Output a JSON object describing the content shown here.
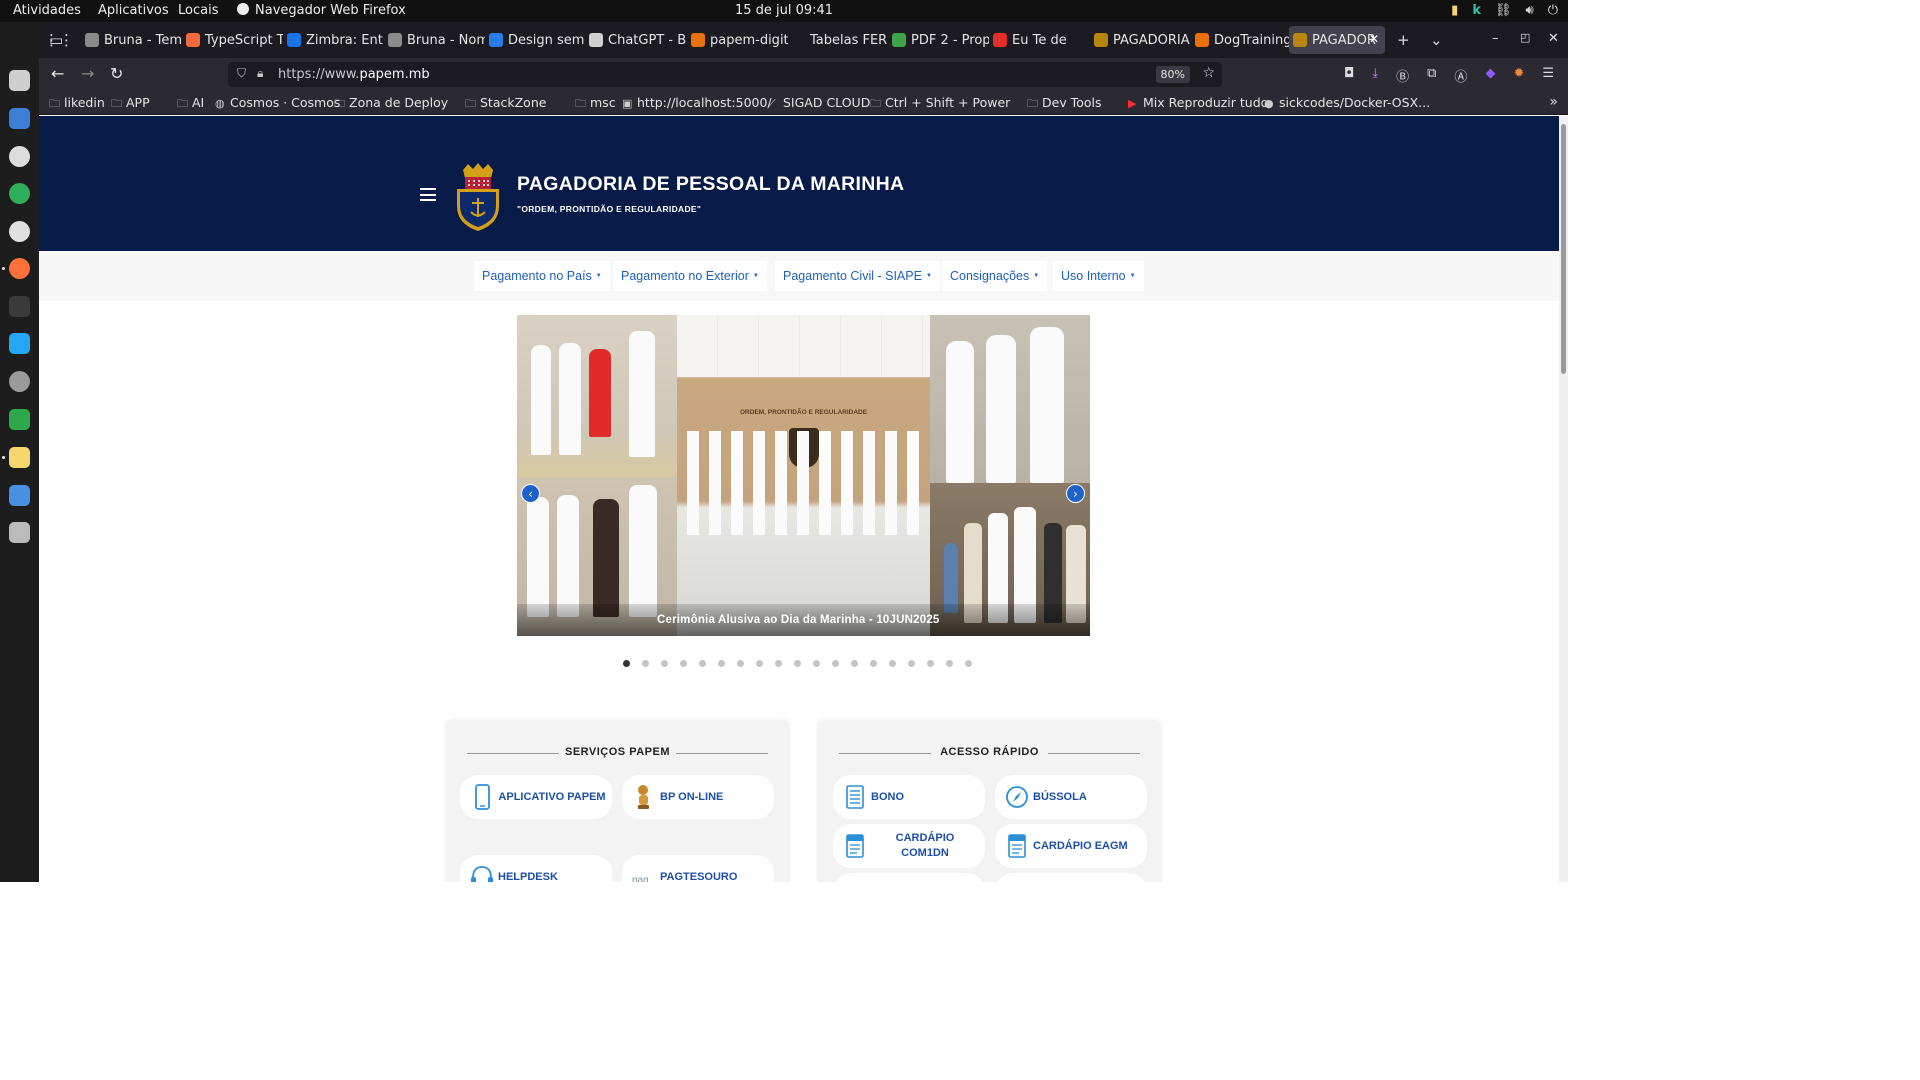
{
  "system": {
    "activities": "Atividades",
    "apps": "Aplicativos",
    "places": "Locais",
    "focused_app": "Navegador Web Firefox",
    "clock": "15 de jul  09:41"
  },
  "browser": {
    "tabs": [
      {
        "label": "Bruna - Tem",
        "color": "#8a8a8a"
      },
      {
        "label": "TypeScript T",
        "color": "#f26b3a"
      },
      {
        "label": "Zimbra: Ent",
        "color": "#1a73e8"
      },
      {
        "label": "Bruna - Nom",
        "color": "#8a8a8a"
      },
      {
        "label": "Design sem",
        "color": "#2b7de9"
      },
      {
        "label": "ChatGPT - B",
        "color": "#cfcfcf"
      },
      {
        "label": "papem-digit",
        "color": "#e8710a"
      },
      {
        "label": "Tabelas FER",
        "color": "#1c1b22"
      },
      {
        "label": "PDF 2 - Prop",
        "color": "#3ea34a"
      },
      {
        "label": "Eu Te de",
        "color": "#e52d27"
      },
      {
        "label": "PAGADORIA",
        "color": "#b8860b"
      },
      {
        "label": "DogTraining",
        "color": "#e8710a"
      },
      {
        "label": "PAGADOR",
        "color": "#b8860b"
      }
    ],
    "url_prefix": "https://www.",
    "url_domain": "papem.mb",
    "zoom": "80%",
    "bookmarks": [
      {
        "label": "likedin",
        "icon": "folder-icon"
      },
      {
        "label": "APP",
        "icon": "folder-icon"
      },
      {
        "label": "AI",
        "icon": "folder-icon"
      },
      {
        "label": "Cosmos · Cosmos",
        "icon": "globe-icon"
      },
      {
        "label": "Zona de Deploy",
        "icon": "folder-icon"
      },
      {
        "label": "StackZone",
        "icon": "folder-icon"
      },
      {
        "label": "msc",
        "icon": "folder-icon"
      },
      {
        "label": "http://localhost:5000/",
        "icon": "page-icon"
      },
      {
        "label": "SIGAD CLOUD",
        "icon": "link-icon"
      },
      {
        "label": "Ctrl + Shift + Power",
        "icon": "folder-icon"
      },
      {
        "label": "Dev Tools",
        "icon": "folder-icon"
      },
      {
        "label": "Mix Reproduzir tudo",
        "icon": "youtube-icon"
      },
      {
        "label": "sickcodes/Docker-OSX...",
        "icon": "github-icon"
      }
    ]
  },
  "site": {
    "title": "PAGADORIA DE PESSOAL DA MARINHA",
    "motto": "\"ORDEM, PRONTIDÃO E REGULARIDADE\"",
    "brand_color": "#071a48",
    "link_color": "#1e5fb6",
    "menu": [
      "Pagamento no País",
      "Pagamento no Exterior",
      "Pagamento Civil - SIAPE",
      "Consignações",
      "Uso Interno"
    ],
    "carousel": {
      "caption": "Cerimônia Alusiva ao Dia da Marinha - 10JUN2025",
      "plaque_text": "ORDEM, PRONTIDÃO E REGULARIDADE",
      "slide_count": 19,
      "active_slide": 1
    },
    "services": {
      "title": "SERVIÇOS PAPEM",
      "items": [
        {
          "label": "APLICATIVO PAPEM",
          "icon": "smartphone-icon"
        },
        {
          "label": "BP ON-LINE",
          "icon": "mascot-icon"
        },
        {
          "label": "HELPDESK",
          "icon": "headset-icon"
        },
        {
          "label": "PAGTESOURO",
          "icon": "pag-icon"
        }
      ]
    },
    "quick_access": {
      "title": "ACESSO RÁPIDO",
      "items": [
        {
          "label": "BONO",
          "icon": "document-list-icon"
        },
        {
          "label": "BÚSSOLA",
          "icon": "compass-icon"
        },
        {
          "label": "CARDÁPIO COM1DN",
          "icon": "menu-card-icon"
        },
        {
          "label": "CARDÁPIO EAGM",
          "icon": "menu-card-icon"
        }
      ]
    }
  }
}
